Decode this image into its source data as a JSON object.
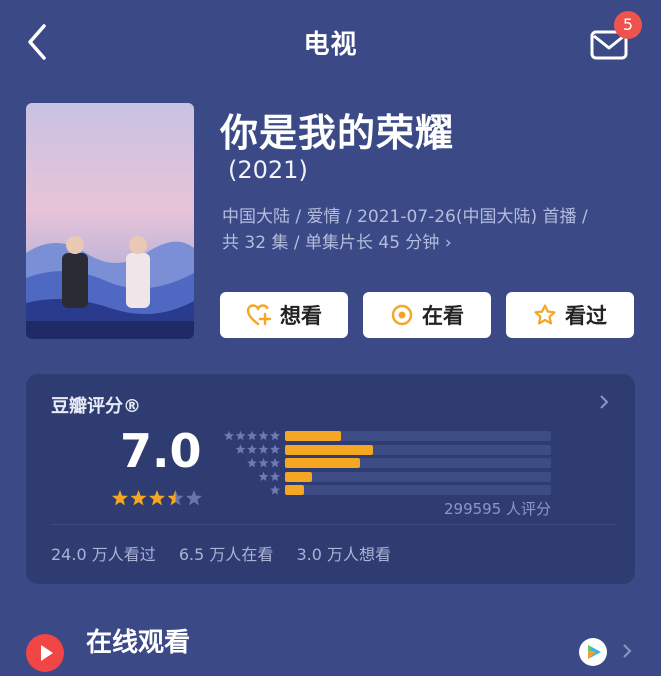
{
  "header": {
    "title": "电视",
    "notification_count": "5"
  },
  "movie": {
    "title": "你是我的荣耀",
    "year": "(2021)",
    "meta_line1": "中国大陆 / 爱情 / 2021-07-26(中国大陆) 首播 /",
    "meta_line2": "共 32 集 / 单集片长 45 分钟",
    "meta_chevron": "›"
  },
  "actions": {
    "want": "想看",
    "watching": "在看",
    "watched": "看过"
  },
  "rating": {
    "label": "豆瓣评分®",
    "score": "7.0",
    "stars": 3.5,
    "distribution": [
      {
        "stars": 5,
        "fraction": 0.21
      },
      {
        "stars": 4,
        "fraction": 0.33
      },
      {
        "stars": 3,
        "fraction": 0.28
      },
      {
        "stars": 2,
        "fraction": 0.1
      },
      {
        "stars": 1,
        "fraction": 0.07
      }
    ],
    "raters": "299595 人评分",
    "seen": "24.0 万人看过",
    "watching": "6.5 万人在看",
    "want": "3.0 万人想看"
  },
  "online": {
    "title": "在线观看"
  },
  "colors": {
    "background": "#3b4a87",
    "card": "#2f3c72",
    "accent": "#f5a623",
    "badge": "#f0534e"
  },
  "icons": {
    "back": "chevron-left-icon",
    "mail": "mail-icon",
    "want": "heart-plus-icon",
    "watching": "circle-dot-icon",
    "watched": "star-outline-icon",
    "play": "play-icon",
    "provider": "tencent-video-icon"
  }
}
